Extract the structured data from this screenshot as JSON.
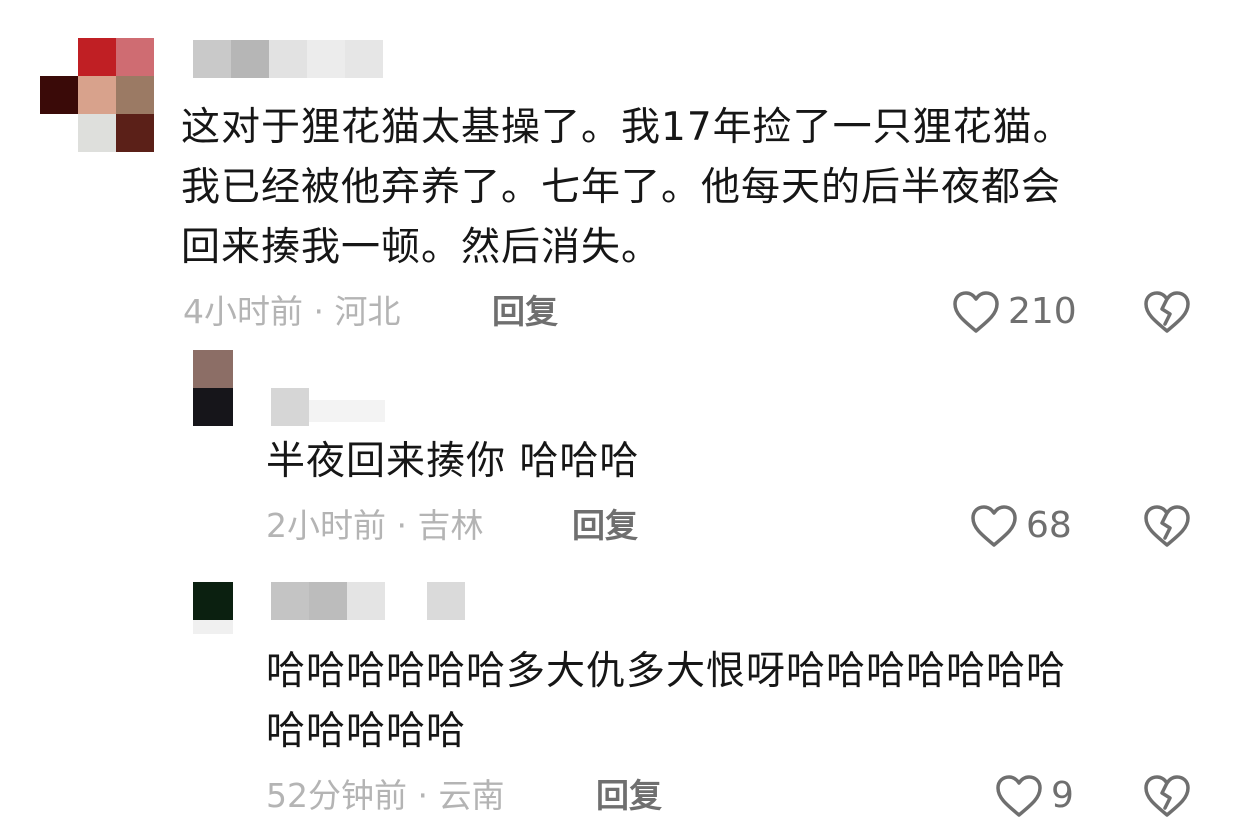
{
  "comments": [
    {
      "text": "这对于狸花猫太基操了。我17年捡了一只狸花猫。\n我已经被他弃养了。七年了。他每天的后半夜都会\n回来揍我一顿。然后消失。",
      "time": "4小时前",
      "location": "河北",
      "reply_label": "回复",
      "likes": "210"
    },
    {
      "text": "半夜回来揍你 哈哈哈",
      "time": "2小时前",
      "location": "吉林",
      "reply_label": "回复",
      "likes": "68"
    },
    {
      "text": "哈哈哈哈哈哈多大仇多大恨呀哈哈哈哈哈哈哈\n哈哈哈哈哈",
      "time": "52分钟前",
      "location": "云南",
      "reply_label": "回复",
      "likes": "9"
    }
  ],
  "meta_separator": " · ",
  "icons": {
    "like": "heart-outline-icon",
    "dislike": "broken-heart-icon"
  },
  "colors": {
    "text": "#161616",
    "meta": "#b4b4b4",
    "action": "#6f6f6f"
  }
}
